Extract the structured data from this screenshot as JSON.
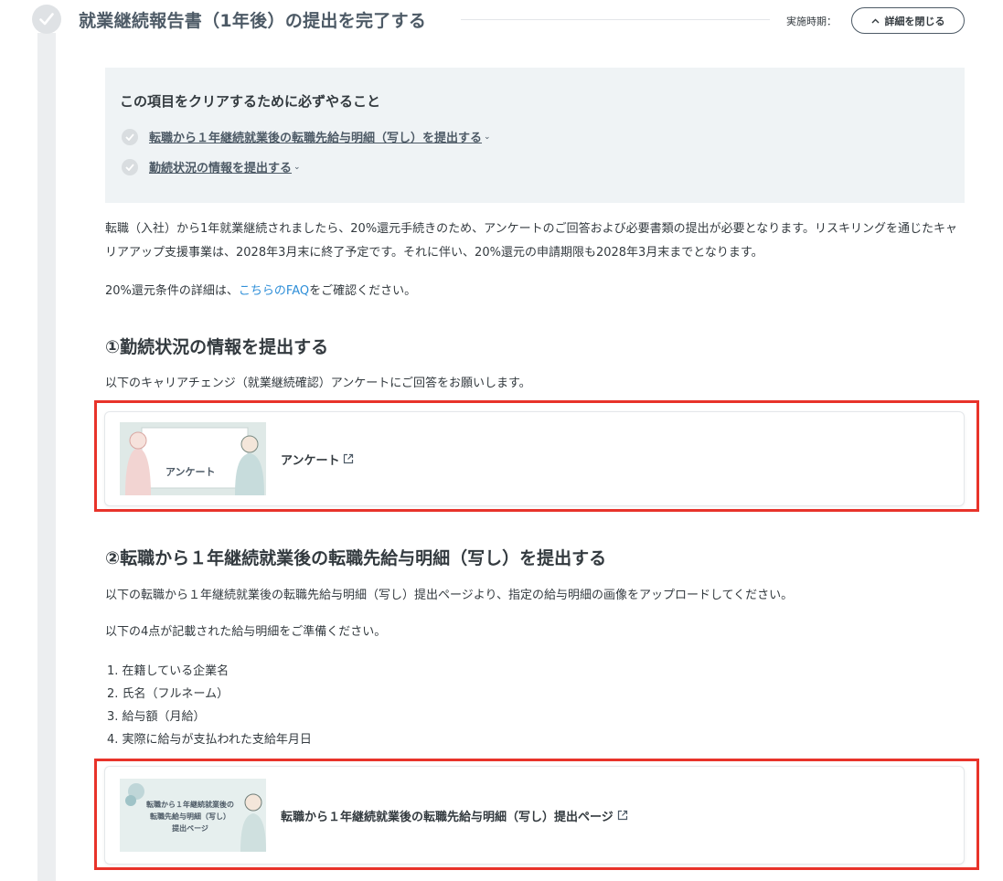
{
  "header": {
    "title": "就業継続報告書（1年後）の提出を完了する",
    "timing_label": "実施時期：",
    "close_button": "詳細を閉じる"
  },
  "requirements": {
    "title": "この項目をクリアするために必ずやること",
    "items": [
      "転職から１年継続就業後の転職先給与明細（写し）を提出する",
      "勤続状況の情報を提出する"
    ]
  },
  "intro": {
    "text": "転職（入社）から1年就業継続されましたら、20%還元手続きのため、アンケートのご回答および必要書類の提出が必要となります。リスキリングを通じたキャリアアップ支援事業は、2028年3月末に終了予定です。それに伴い、20%還元の申請期限も2028年3月末までとなります。",
    "faq_prefix": "20%還元条件の詳細は、",
    "faq_link": "こちらのFAQ",
    "faq_suffix": "をご確認ください。"
  },
  "section1": {
    "heading": "①勤続状況の情報を提出する",
    "text": "以下のキャリアチェンジ（就業継続確認）アンケートにご回答をお願いします。",
    "card": {
      "thumb_text": "アンケート",
      "label": "アンケート"
    }
  },
  "section2": {
    "heading": "②転職から１年継続就業後の転職先給与明細（写し）を提出する",
    "text1": "以下の転職から１年継続就業後の転職先給与明細（写し）提出ページより、指定の給与明細の画像をアップロードしてください。",
    "text2": "以下の4点が記載された給与明細をご準備ください。",
    "list": [
      "1. 在籍している企業名",
      "2. 氏名（フルネーム）",
      "3. 給与額（月給）",
      "4. 実際に給与が支払われた支給年月日"
    ],
    "card": {
      "thumb_line1": "転職から１年継続就業後の",
      "thumb_line2": "転職先給与明細（写し）",
      "thumb_line3": "提出ページ",
      "label": "転職から１年継続就業後の転職先給与明細（写し）提出ページ"
    }
  }
}
